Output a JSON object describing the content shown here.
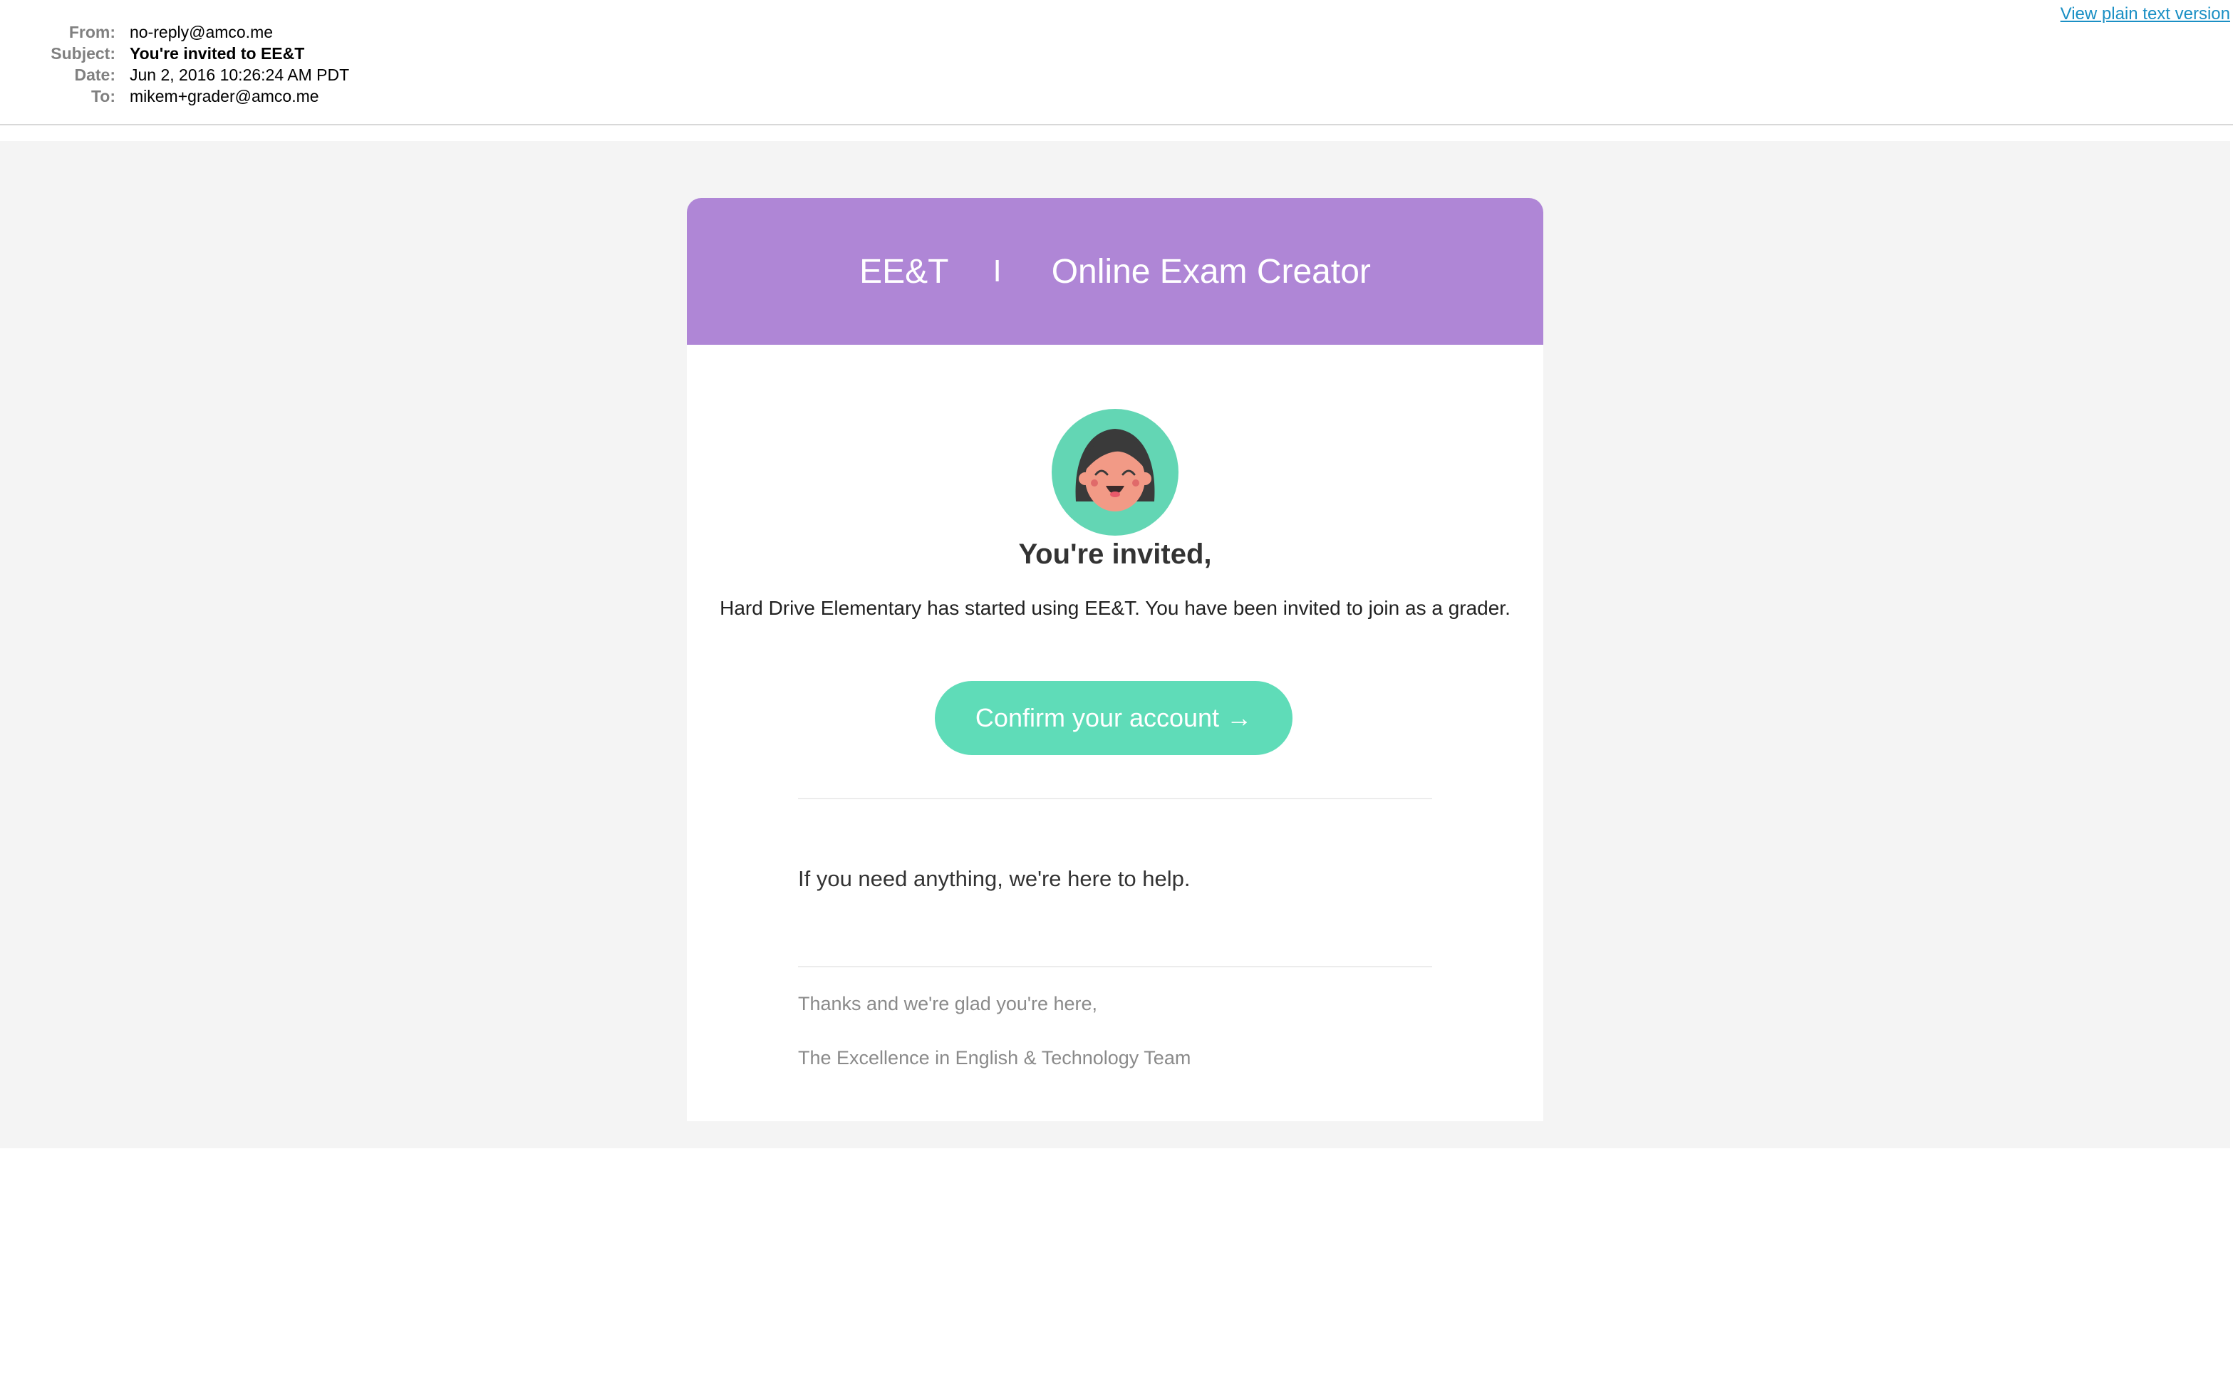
{
  "header": {
    "from_label": "From:",
    "from_value": "no-reply@amco.me",
    "subject_label": "Subject:",
    "subject_value": "You're invited to EE&T",
    "date_label": "Date:",
    "date_value": "Jun 2, 2016 10:26:24 AM PDT",
    "to_label": "To:",
    "to_value": "mikem+grader@amco.me",
    "plain_text_link": "View plain text version"
  },
  "banner": {
    "brand": "EE&T",
    "separator": "I",
    "product": "Online Exam Creator",
    "color": "#af86d6"
  },
  "avatar": {
    "icon": "smiling-girl-avatar-icon",
    "bg_color": "#63d6b4"
  },
  "content": {
    "title": "You're invited,",
    "message": "Hard Drive Elementary has started using EE&T. You have been invited to join as a grader.",
    "cta_label": "Confirm your account →",
    "cta_color": "#5fdcb8",
    "help_text": "If you need anything, we're here to help.",
    "thanks": "Thanks and we're glad you're here,",
    "team": "The Excellence in English & Technology Team"
  }
}
